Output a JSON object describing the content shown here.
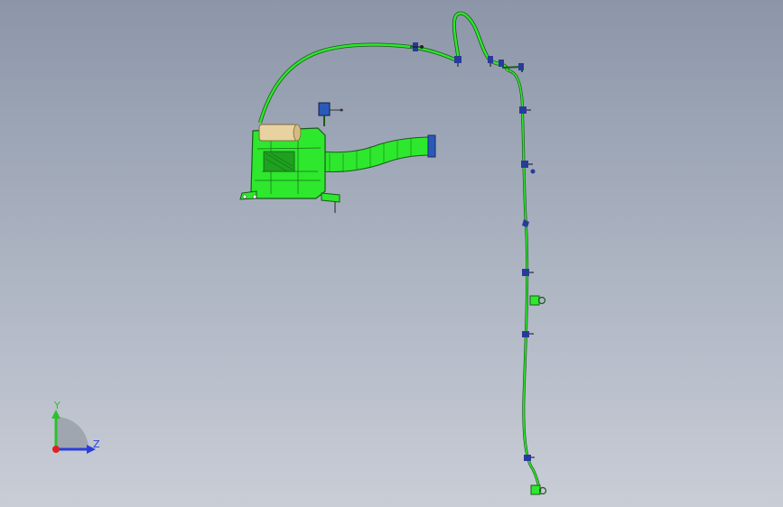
{
  "view": {
    "background_top": "#8c96a8",
    "background_bottom": "#c9cdd6"
  },
  "model": {
    "part_color": "#2de82d",
    "outline_color": "#1a5a1a",
    "clip_color": "#2a3a9a",
    "cylinder_color": "#e8d2a0"
  },
  "triad": {
    "y_label": "Y",
    "z_label": "Z",
    "y_color": "#2fbf2f",
    "z_color": "#2a3fd8",
    "x_color": "#e02020"
  }
}
